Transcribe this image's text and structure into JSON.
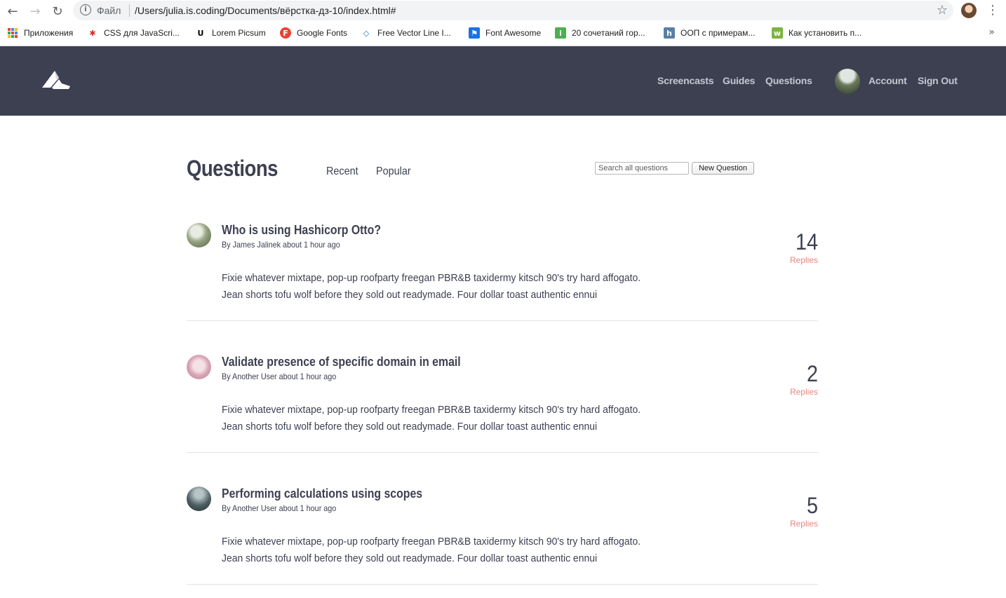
{
  "browser": {
    "scheme_label": "Файл",
    "url": "/Users/julia.is.coding/Documents/вёрстка-дз-10/index.html#",
    "bookmarks": [
      {
        "label": "Приложения",
        "icon": "apps-grid-icon"
      },
      {
        "label": "CSS для JavaScri...",
        "icon": "figure-icon",
        "color": "#d93025"
      },
      {
        "label": "Lorem Picsum",
        "icon": "u-letter-icon",
        "color": "#000000"
      },
      {
        "label": "Google Fonts",
        "icon": "f-letter-icon",
        "color": "#ea4335"
      },
      {
        "label": "Free Vector Line I...",
        "icon": "diamond-icon",
        "color": "#1a73e8"
      },
      {
        "label": "Font Awesome",
        "icon": "flag-icon",
        "color": "#1a73e8"
      },
      {
        "label": "20 сочетаний гор...",
        "icon": "green-square-icon",
        "color": "#4caf50"
      },
      {
        "label": "ООП с примерам...",
        "icon": "h-letter-icon",
        "color": "#5b7fa3"
      },
      {
        "label": "Как установить п...",
        "icon": "green-square-icon",
        "color": "#7cb342"
      }
    ],
    "more": "»"
  },
  "header": {
    "bg_color": "#3d4051",
    "nav": {
      "screencasts": "Screencasts",
      "guides": "Guides",
      "questions": "Questions",
      "account": "Account",
      "signout": "Sign Out"
    }
  },
  "main": {
    "title": "Questions",
    "tabs": {
      "recent": "Recent",
      "popular": "Popular"
    },
    "search_placeholder": "Search all questions",
    "new_question": "New Question"
  },
  "questions": [
    {
      "title": "Who is using Hashicorp Otto?",
      "meta": "By James Jalinek about 1 hour ago",
      "body_line1": "Fixie whatever mixtape, pop-up roofparty freegan PBR&B taxidermy kitsch 90's try hard affogato.",
      "body_line2": "Jean shorts tofu wolf before they sold out readymade. Four dollar toast authentic ennui",
      "replies_count": "14",
      "replies_label": "Replies"
    },
    {
      "title": "Validate presence of specific domain in email",
      "meta": "By Another User about 1 hour ago",
      "body_line1": "Fixie whatever mixtape, pop-up roofparty freegan PBR&B taxidermy kitsch 90's try hard affogato.",
      "body_line2": "Jean shorts tofu wolf before they sold out readymade. Four dollar toast authentic ennui",
      "replies_count": "2",
      "replies_label": "Replies"
    },
    {
      "title": "Performing calculations using scopes",
      "meta": "By Another User about 1 hour ago",
      "body_line1": "Fixie whatever mixtape, pop-up roofparty freegan PBR&B taxidermy kitsch 90's try hard affogato.",
      "body_line2": "Jean shorts tofu wolf before they sold out readymade. Four dollar toast authentic ennui",
      "replies_count": "5",
      "replies_label": "Replies"
    }
  ]
}
